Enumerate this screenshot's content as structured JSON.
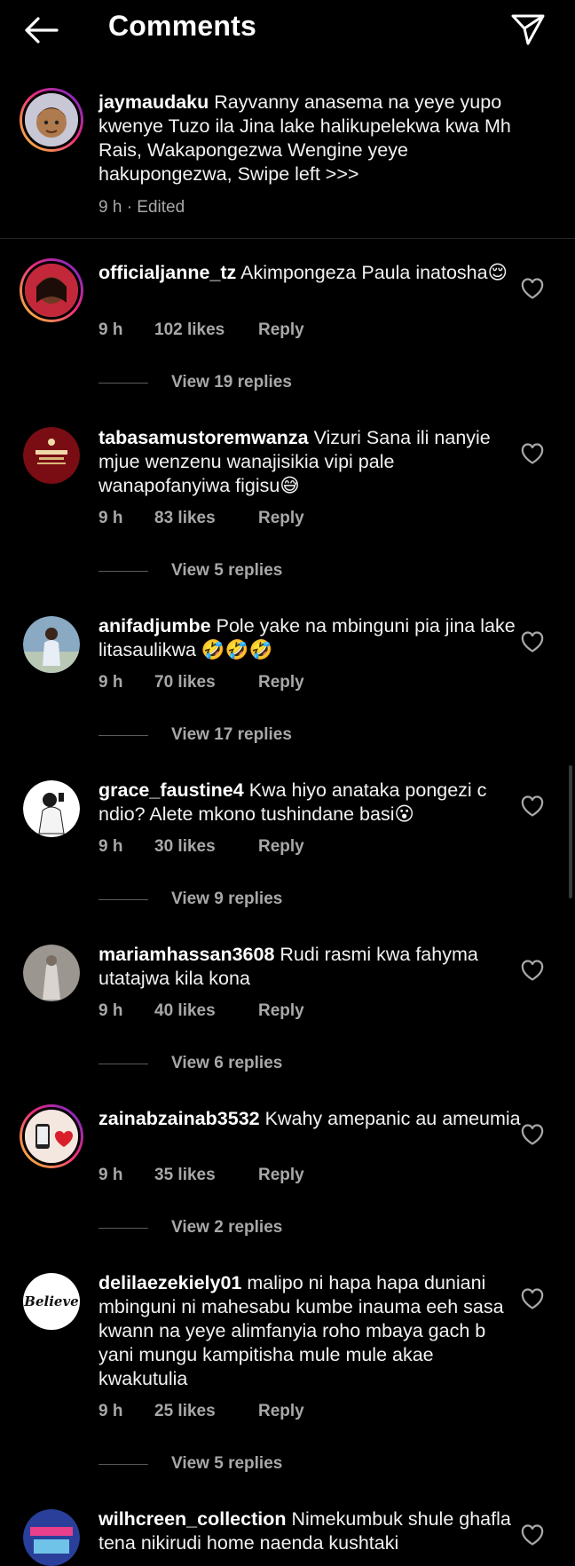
{
  "header": {
    "title": "Comments"
  },
  "caption": {
    "username": "jaymaudaku",
    "text": "Rayvanny anasema na yeye yupo kwenye Tuzo ila Jina lake halikupelekwa kwa Mh Rais, Wakapongezwa Wengine yeye hakupongezwa, Swipe left >>>",
    "time": "9 h · Edited"
  },
  "comments": [
    {
      "username": "officialjanne_tz",
      "text": "Akimpongeza Paula inatosha😌",
      "time": "9 h",
      "likes": "102 likes",
      "reply": "Reply",
      "view_replies": "View 19 replies"
    },
    {
      "username": "tabasamustoremwanza",
      "text": "Vizuri Sana ili nanyie mjue wenzenu wanajisikia vipi pale wanapofanyiwa figisu😅",
      "time": "9 h",
      "likes": "83 likes",
      "reply": "Reply",
      "view_replies": "View 5 replies"
    },
    {
      "username": "anifadjumbe",
      "text": "Pole yake na mbinguni pia jina lake litasaulikwa 🤣🤣🤣",
      "time": "9 h",
      "likes": "70 likes",
      "reply": "Reply",
      "view_replies": "View 17 replies"
    },
    {
      "username": "grace_faustine4",
      "text": "Kwa hiyo anataka pongezi c ndio? Alete mkono tushindane basi😮",
      "time": "9 h",
      "likes": "30 likes",
      "reply": "Reply",
      "view_replies": "View 9 replies"
    },
    {
      "username": "mariamhassan3608",
      "text": "Rudi  rasmi kwa fahyma utatajwa kila kona",
      "time": "9 h",
      "likes": "40 likes",
      "reply": "Reply",
      "view_replies": "View 6 replies"
    },
    {
      "username": "zainabzainab3532",
      "text": "Kwahy amepanic au ameumia",
      "time": "9 h",
      "likes": "35 likes",
      "reply": "Reply",
      "view_replies": "View 2 replies"
    },
    {
      "username": "delilaezekiely01",
      "text": "malipo ni hapa hapa duniani mbinguni ni mahesabu kumbe inauma eeh sasa kwann na yeye alimfanyia roho mbaya gach b yani mungu kampitisha mule mule akae kwakutulia",
      "time": "9 h",
      "likes": "25 likes",
      "reply": "Reply",
      "view_replies": "View 5 replies"
    },
    {
      "username": "wilhcreen_collection",
      "text": "Nimekumbuk shule ghafla tena nikirudi home naenda kushtaki"
    }
  ],
  "avatar_labels": {
    "delila": "Believe"
  },
  "colors": {
    "background": "#000000",
    "secondary_text": "#a8a8a8",
    "divider": "#262626"
  }
}
